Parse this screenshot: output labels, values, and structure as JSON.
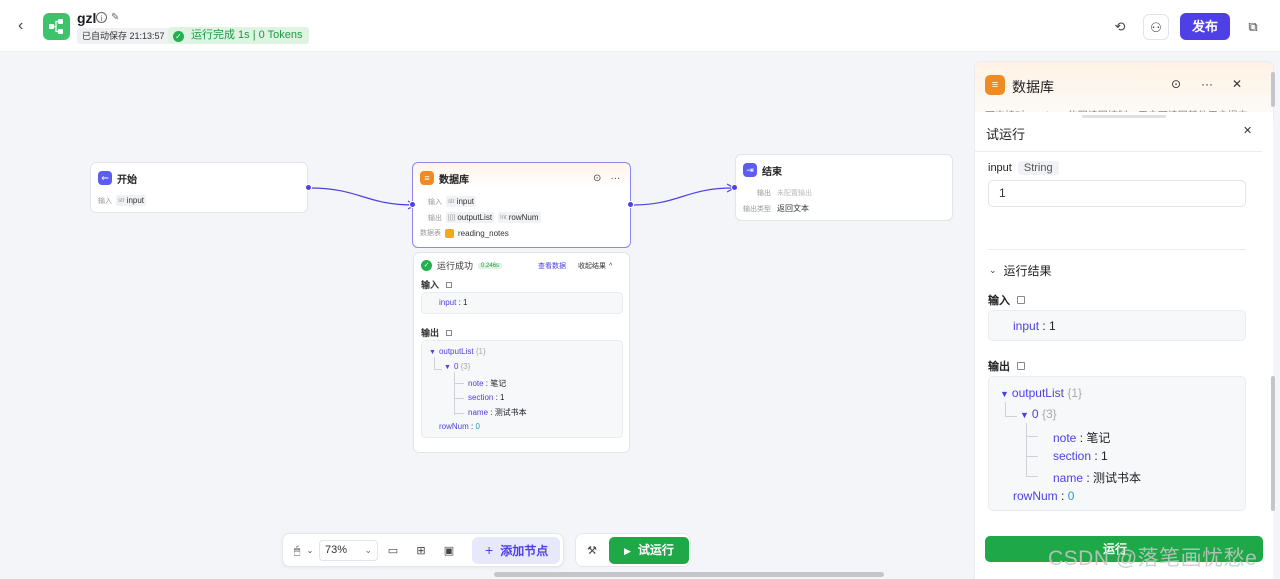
{
  "header": {
    "app_name": "gzl",
    "autosave": "已自动保存 21:13:57",
    "run_status": "运行完成 1s | 0 Tokens",
    "publish_label": "发布"
  },
  "nodes": {
    "start": {
      "title": "开始",
      "input_label": "输入",
      "input_type": "str",
      "input_name": "input"
    },
    "database": {
      "title": "数据库",
      "input_label": "输入",
      "input_type": "str",
      "input_name": "input",
      "output_label": "输出",
      "output1_type": "[{}]",
      "output1_name": "outputList",
      "output2_type": "Int",
      "output2_name": "rowNum",
      "table_label": "数据表",
      "table_name": "reading_notes"
    },
    "end": {
      "title": "结束",
      "output_label": "输出",
      "output_value": "未配置输出",
      "output_type_label": "输出类型",
      "output_type_value": "返回文本"
    }
  },
  "result_card": {
    "status": "运行成功",
    "duration": "0.246s",
    "view_data": "查看数据",
    "collapse": "收起结果",
    "input_label": "输入",
    "output_label": "输出",
    "input_key": "input",
    "input_value": "1",
    "output_list_key": "outputList",
    "output_list_count": "{1}",
    "item_key": "0",
    "item_count": "{3}",
    "note_key": "note",
    "note_value": "笔记",
    "section_key": "section",
    "section_value": "1",
    "name_key": "name",
    "name_value": "测试书本",
    "rownum_key": "rowNum",
    "rownum_value": "0"
  },
  "toolbar": {
    "zoom": "73%",
    "add_node": "添加节点",
    "trial_run": "试运行"
  },
  "side_panel": {
    "title": "数据库",
    "description": "可支持对Database的写读写控制，用户可读写其他用户提交",
    "run_title": "试运行",
    "param_name": "input",
    "param_type": "String",
    "param_value": "1",
    "result_header": "运行结果",
    "input_label": "输入",
    "output_label": "输出",
    "run_button": "运行"
  },
  "watermark": "CSDN @落笔画忧愁e",
  "colors": {
    "brand": "#4e40e5",
    "success": "#1fa847",
    "database": "#f08b23"
  }
}
